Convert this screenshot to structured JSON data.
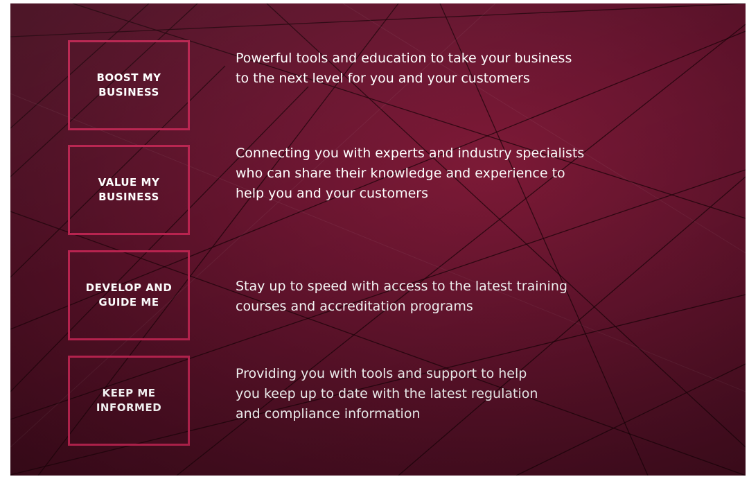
{
  "features": [
    {
      "label": "BOOST MY\nBUSINESS",
      "description": "Powerful tools and education to take your business\nto the next level for you and your customers"
    },
    {
      "label": "VALUE MY\nBUSINESS",
      "description": "Connecting you with experts and industry specialists\nwho can share their knowledge and experience to\nhelp you and your customers"
    },
    {
      "label": "DEVELOP AND\nGUIDE ME",
      "description": "Stay up to speed with access to the latest training\ncourses and accreditation programs"
    },
    {
      "label": "KEEP ME\nINFORMED",
      "description": "Providing you with tools and support to help\nyou keep up to date with the latest regulation\nand compliance information"
    }
  ],
  "colors": {
    "background": "#5c1229",
    "badge_border": "#b8234f",
    "text": "#ffffff"
  }
}
